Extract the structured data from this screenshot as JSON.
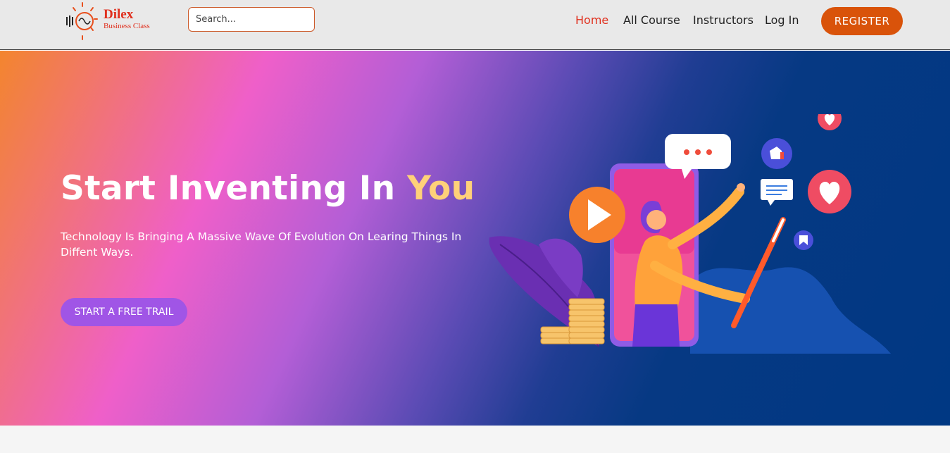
{
  "brand": {
    "name": "Dilex",
    "subtitle": "Business Class",
    "color": "#e0301e"
  },
  "search": {
    "placeholder": "Search...",
    "value": ""
  },
  "nav": {
    "items": [
      {
        "label": "Home",
        "active": true
      },
      {
        "label": "All Course",
        "active": false
      },
      {
        "label": "Instructors",
        "active": false
      },
      {
        "label": "Log In",
        "active": false
      }
    ],
    "register_label": "REGISTER"
  },
  "hero": {
    "title_main": "Start Inventing In ",
    "title_accent": "You",
    "subtitle": "Technology Is Bringing A Massive Wave Of Evolution On Learing Things In Diffent Ways.",
    "cta_label": "START A FREE TRAIL"
  },
  "icons": {
    "play": "play-icon",
    "chat": "chat-bubble-icon",
    "heart": "heart-icon",
    "like": "thumbs-up-icon",
    "message": "message-icon",
    "leaf": "leaf-icon",
    "coins": "coins-icon"
  },
  "colors": {
    "accent_orange": "#d9530a",
    "title_accent": "#ffd179",
    "cta_purple": "#a055e6",
    "hero_gradient": [
      "#f3852e",
      "#ef5fc9",
      "#5a4bb4",
      "#003883"
    ]
  }
}
